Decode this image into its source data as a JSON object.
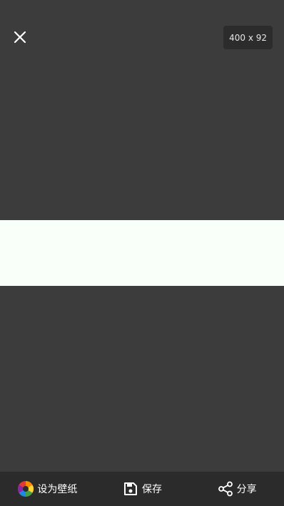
{
  "topbar": {
    "close_icon": "close-icon",
    "dimensions_label": "400 x 92"
  },
  "preview": {
    "image_color": "#f9fff9",
    "background_color": "#3c3c3c"
  },
  "bottom_bar": {
    "actions": [
      {
        "label": "设为壁纸",
        "icon": "color-wheel-icon"
      },
      {
        "label": "保存",
        "icon": "save-icon"
      },
      {
        "label": "分享",
        "icon": "share-icon"
      }
    ]
  }
}
